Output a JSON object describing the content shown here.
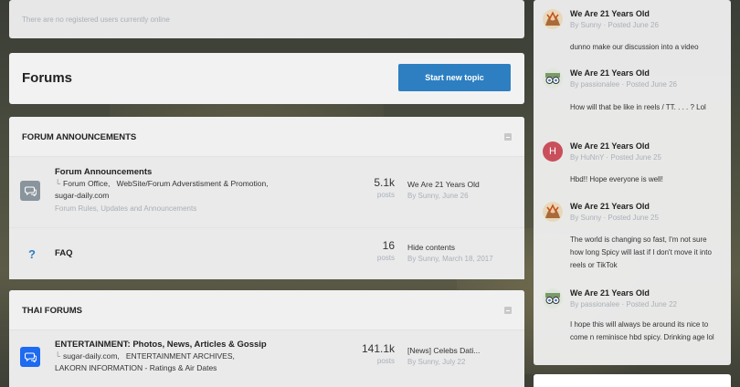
{
  "online": {
    "text": "There are no registered users currently online"
  },
  "header": {
    "title": "Forums",
    "start_button": "Start new topic"
  },
  "categories": [
    {
      "title": "FORUM ANNOUNCEMENTS",
      "forums": [
        {
          "name": "Forum Announcements",
          "subforums": [
            "Forum Office,",
            "WebSite/Forum Adverstisment & Promotion,",
            "sugar-daily.com"
          ],
          "description": "Forum Rules, Updates and Announcements",
          "count": "5.1k",
          "count_label": "posts",
          "last_title": "We Are 21 Years Old",
          "last_by": "By Sunny, June 26",
          "icon": "chat-bubbles-icon"
        },
        {
          "name": "FAQ",
          "count": "16",
          "count_label": "posts",
          "last_title": "Hide contents",
          "last_by": "By Sunny, March 18, 2017",
          "icon": "question-icon"
        }
      ]
    },
    {
      "title": "THAI FORUMS",
      "forums": [
        {
          "name": "ENTERTAINMENT: Photos, News, Articles & Gossip",
          "subforums": [
            "sugar-daily.com,",
            "ENTERTAINMENT ARCHIVES,",
            "LAKORN INFORMATION - Ratings & Air Dates"
          ],
          "count": "141.1k",
          "count_label": "posts",
          "last_title": "[News] Celebs Dati...",
          "last_by": "By Sunny, July 22",
          "icon": "chat-bubbles-icon"
        }
      ]
    }
  ],
  "activity": [
    {
      "title": "We Are 21 Years Old",
      "byline": "By Sunny · Posted June 26",
      "content": "dunno make our discussion into a video",
      "avatar": "sunny-avatar"
    },
    {
      "title": "We Are 21 Years Old",
      "byline": "By passionalee · Posted June 26",
      "content": "How will that be like in reels / TT. . . . ? Lol",
      "avatar": "passionalee-avatar"
    },
    {
      "title": "We Are 21 Years Old",
      "byline": "By HuNnY · Posted June 25",
      "content": "Hbd!! Hope everyone is well!",
      "avatar": "H",
      "avatar_color": "#c94f5a"
    },
    {
      "title": "We Are 21 Years Old",
      "byline": "By Sunny · Posted June 25",
      "content": "The world is changing so fast, I'm not sure how long Spicy will last if I don't move it into reels or TikTok",
      "avatar": "sunny-avatar"
    },
    {
      "title": "We Are 21 Years Old",
      "byline": "By passionalee · Posted June 22",
      "content": "I hope this will always be around its nice to come n reminisce  hbd spicy. Drinking age lol",
      "avatar": "passionalee-avatar"
    }
  ],
  "colors": {
    "accent": "#2d7fc1",
    "forum_icon_blue": "#1e6af0",
    "forum_icon_gray": "#8a949c"
  }
}
